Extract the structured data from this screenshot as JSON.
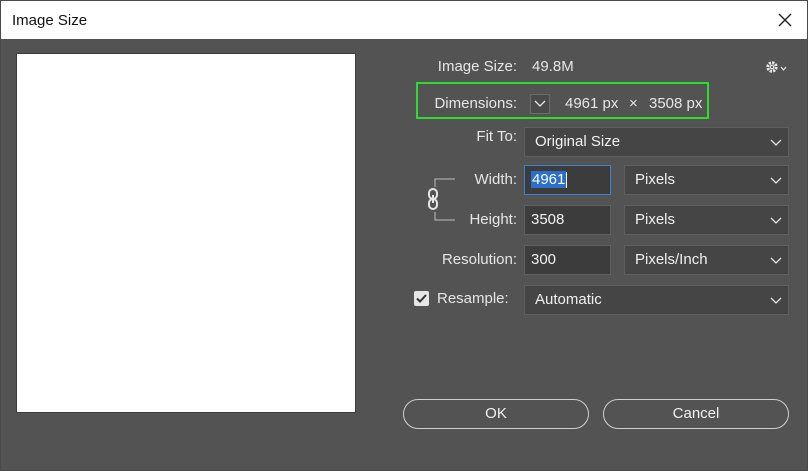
{
  "window": {
    "title": "Image Size",
    "close_icon": "close-icon"
  },
  "info": {
    "image_size_label": "Image Size:",
    "image_size_value": "49.8M",
    "dimensions_label": "Dimensions:",
    "dimensions_width": "4961 px",
    "dimensions_times": "×",
    "dimensions_height": "3508 px"
  },
  "fit_to": {
    "label": "Fit To:",
    "value": "Original Size"
  },
  "width": {
    "label": "Width:",
    "value": "4961",
    "unit": "Pixels"
  },
  "height": {
    "label": "Height:",
    "value": "3508",
    "unit": "Pixels"
  },
  "resolution": {
    "label": "Resolution:",
    "value": "300",
    "unit": "Pixels/Inch"
  },
  "resample": {
    "label": "Resample:",
    "checked": true,
    "value": "Automatic"
  },
  "buttons": {
    "ok": "OK",
    "cancel": "Cancel"
  },
  "colors": {
    "highlight": "#2ddc2d",
    "dialog_bg": "#535353",
    "focus": "#3a84c9"
  }
}
